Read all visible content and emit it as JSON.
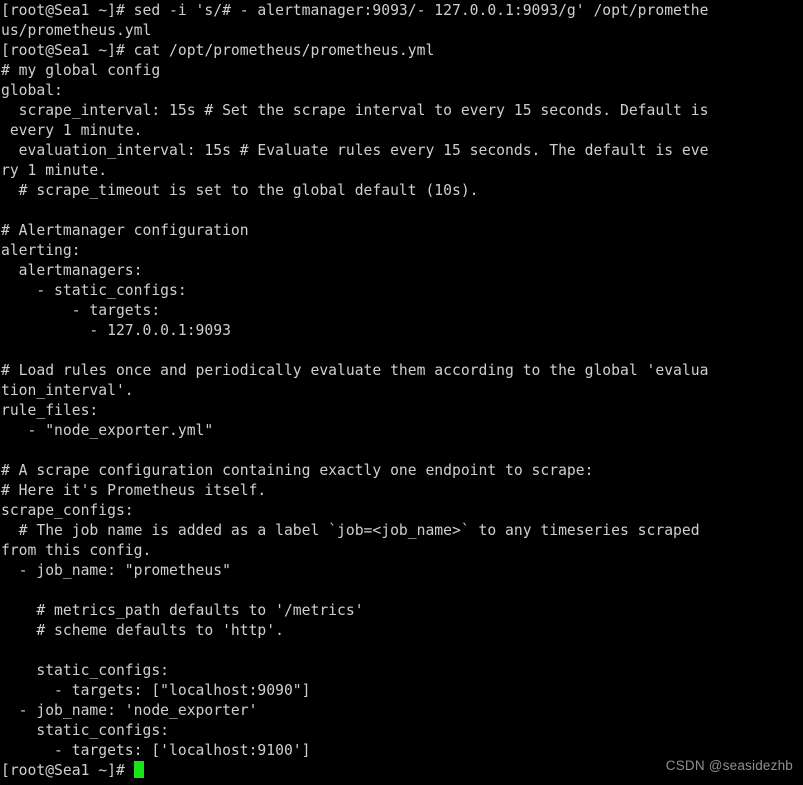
{
  "terminal": {
    "app": "bash-terminal",
    "background_color": "#000000",
    "foreground_color": "#cfcfcf",
    "cursor_color": "#19e619",
    "columns": 80,
    "prompt": "[root@Sea1 ~]# ",
    "hostname": "Sea1",
    "user": "root",
    "cwd_symbol": "~",
    "lines": [
      "[root@Sea1 ~]# sed -i 's/# - alertmanager:9093/- 127.0.0.1:9093/g' /opt/promethe",
      "us/prometheus.yml",
      "[root@Sea1 ~]# cat /opt/prometheus/prometheus.yml",
      "# my global config",
      "global:",
      "  scrape_interval: 15s # Set the scrape interval to every 15 seconds. Default is",
      " every 1 minute.",
      "  evaluation_interval: 15s # Evaluate rules every 15 seconds. The default is eve",
      "ry 1 minute.",
      "  # scrape_timeout is set to the global default (10s).",
      "",
      "# Alertmanager configuration",
      "alerting:",
      "  alertmanagers:",
      "    - static_configs:",
      "        - targets:",
      "          - 127.0.0.1:9093",
      "",
      "# Load rules once and periodically evaluate them according to the global 'evalua",
      "tion_interval'.",
      "rule_files:",
      "   - \"node_exporter.yml\"",
      "",
      "# A scrape configuration containing exactly one endpoint to scrape:",
      "# Here it's Prometheus itself.",
      "scrape_configs:",
      "  # The job name is added as a label `job=<job_name>` to any timeseries scraped",
      "from this config.",
      "  - job_name: \"prometheus\"",
      "",
      "    # metrics_path defaults to '/metrics'",
      "    # scheme defaults to 'http'.",
      "",
      "    static_configs:",
      "      - targets: [\"localhost:9090\"]",
      "  - job_name: 'node_exporter'",
      "    static_configs:",
      "      - targets: ['localhost:9100']"
    ],
    "final_prompt": "[root@Sea1 ~]# ",
    "cursor_glyph": "block-cursor"
  },
  "watermark": {
    "text": "CSDN @seasidezhb"
  }
}
